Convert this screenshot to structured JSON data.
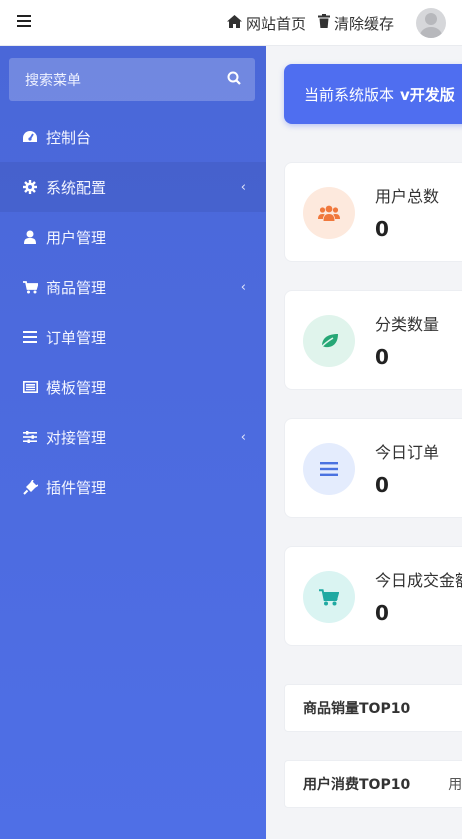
{
  "topbar": {
    "home_label": "网站首页",
    "clear_cache_label": "清除缓存"
  },
  "sidebar": {
    "search_placeholder": "搜索菜单",
    "items": [
      {
        "label": "控制台",
        "icon": "dashboard-icon",
        "chevron": false
      },
      {
        "label": "系统配置",
        "icon": "gear-icon",
        "chevron": true
      },
      {
        "label": "用户管理",
        "icon": "user-icon",
        "chevron": false
      },
      {
        "label": "商品管理",
        "icon": "cart-icon",
        "chevron": true
      },
      {
        "label": "订单管理",
        "icon": "list-icon",
        "chevron": false
      },
      {
        "label": "模板管理",
        "icon": "template-icon",
        "chevron": false
      },
      {
        "label": "对接管理",
        "icon": "sliders-icon",
        "chevron": true
      },
      {
        "label": "插件管理",
        "icon": "plug-icon",
        "chevron": false
      }
    ],
    "chevron_glyph": "‹"
  },
  "content": {
    "version_text": "当前系统版本",
    "version_value": "v开发版",
    "stats": [
      {
        "title": "用户总数",
        "value": "0",
        "icon": "users-icon",
        "bg": "#fde9dd",
        "fg": "#f0783c"
      },
      {
        "title": "分类数量",
        "value": "0",
        "icon": "leaf-icon",
        "bg": "#e0f4ec",
        "fg": "#27a776"
      },
      {
        "title": "今日订单",
        "value": "0",
        "icon": "list-icon",
        "bg": "#e4ecfd",
        "fg": "#4a72e0"
      },
      {
        "title": "今日成交金额",
        "value": "0",
        "icon": "cart-icon",
        "bg": "#daf4f2",
        "fg": "#1fa9a2"
      }
    ],
    "panels": [
      {
        "title": "商品销量TOP10",
        "extra": ""
      },
      {
        "title": "用户消费TOP10",
        "extra": "用"
      }
    ]
  },
  "colors": {
    "sidebar": "#4f6fe6",
    "banner": "#4f6ef0"
  }
}
